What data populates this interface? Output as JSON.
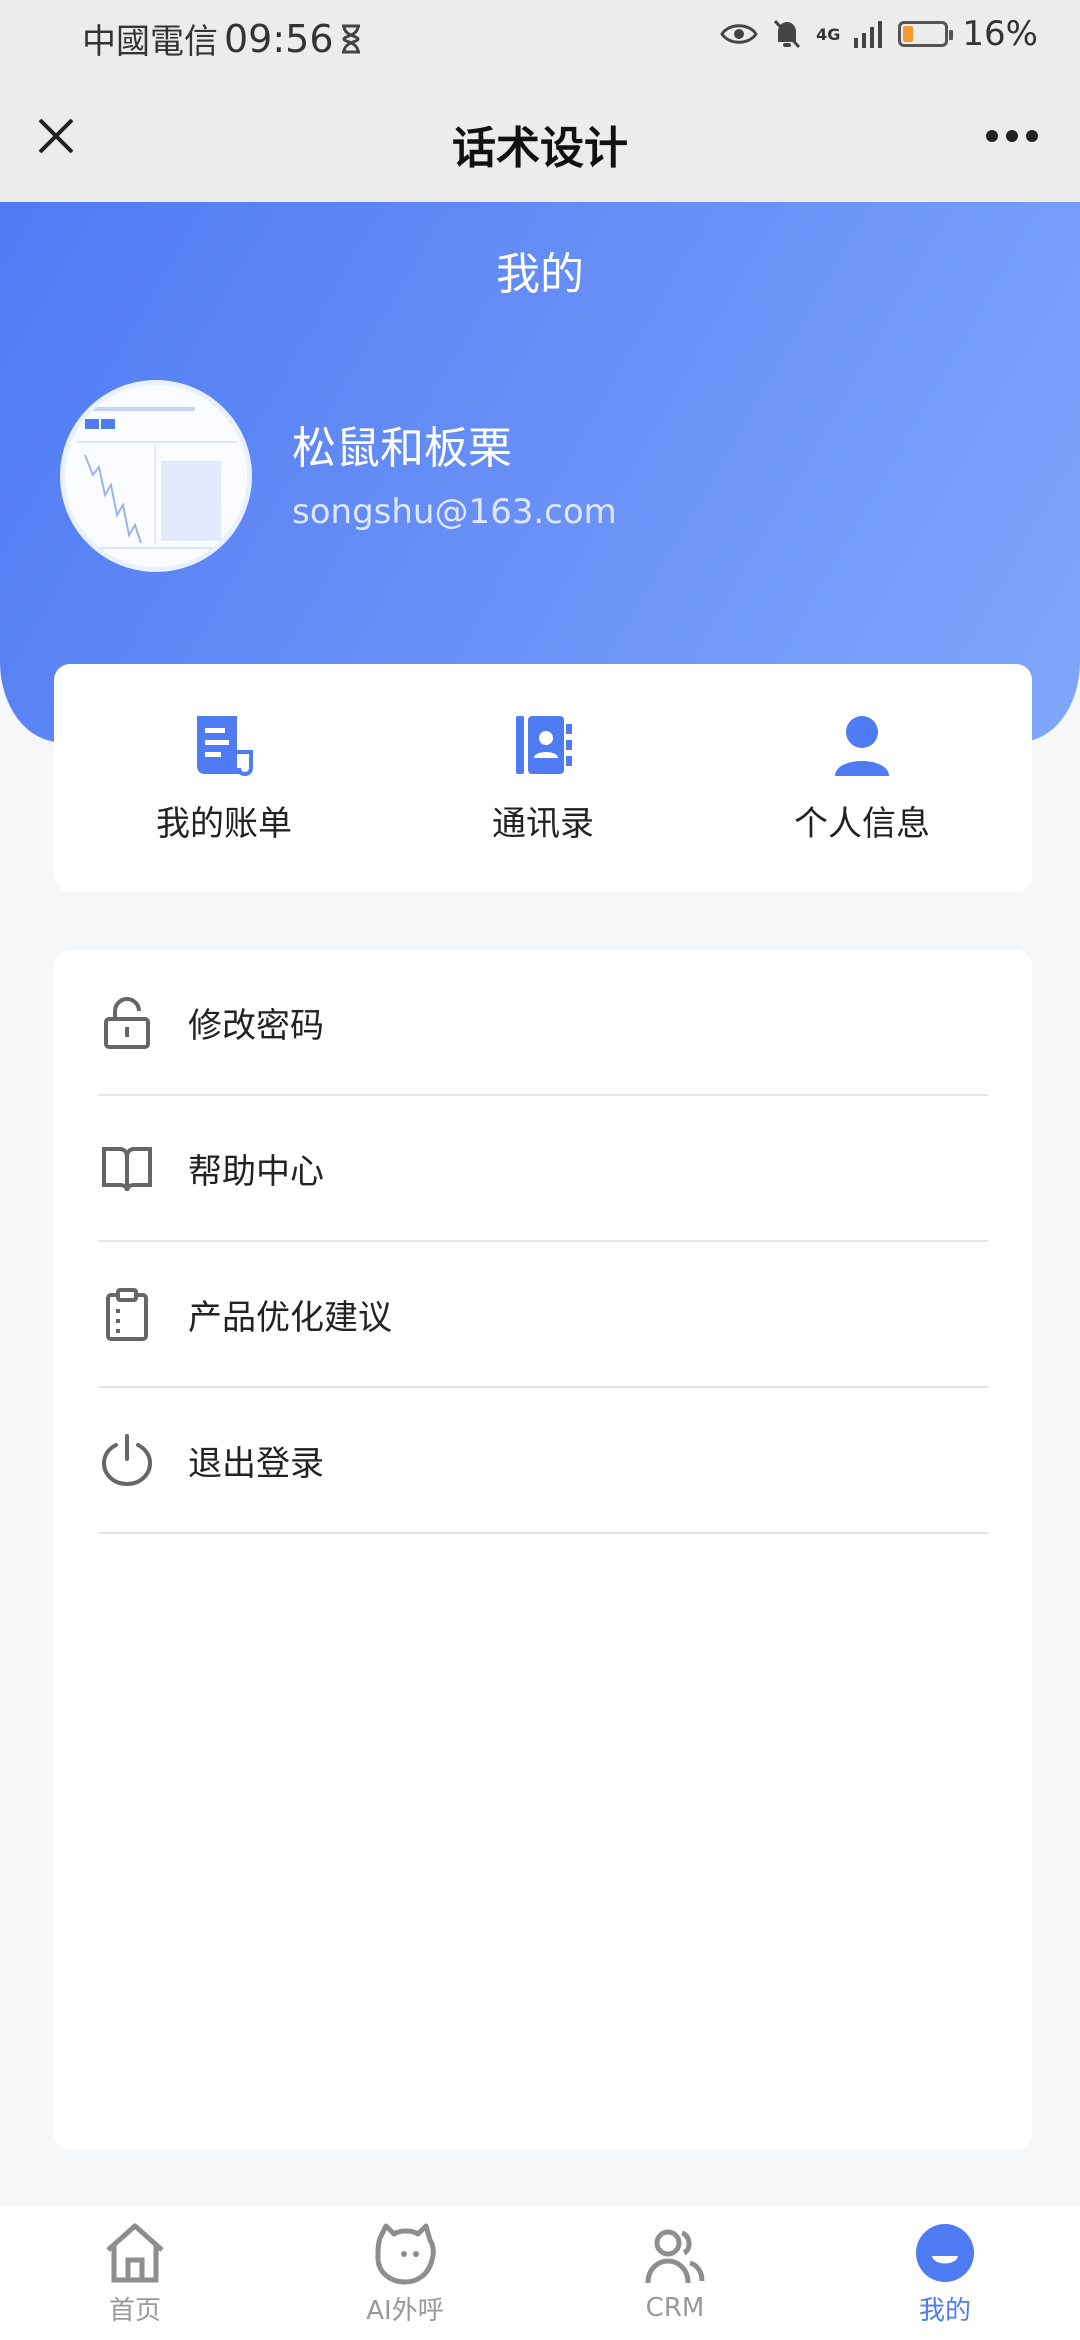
{
  "status_bar": {
    "carrier": "中國電信",
    "time": "09:56",
    "network": "4G",
    "battery": "16%"
  },
  "title_bar": {
    "title": "话术设计"
  },
  "header": {
    "title": "我的",
    "user_name": "松鼠和板栗",
    "user_email": "songshu@163.com"
  },
  "quick_actions": [
    {
      "label": "我的账单",
      "icon": "bill-icon"
    },
    {
      "label": "通讯录",
      "icon": "contacts-book-icon"
    },
    {
      "label": "个人信息",
      "icon": "person-icon"
    }
  ],
  "menu": [
    {
      "label": "修改密码",
      "icon": "unlock-icon"
    },
    {
      "label": "帮助中心",
      "icon": "book-icon"
    },
    {
      "label": "产品优化建议",
      "icon": "clipboard-icon"
    },
    {
      "label": "退出登录",
      "icon": "power-icon"
    }
  ],
  "bottom_nav": [
    {
      "label": "首页",
      "icon": "home-icon"
    },
    {
      "label": "AI外呼",
      "icon": "robot-icon"
    },
    {
      "label": "CRM",
      "icon": "users-icon"
    },
    {
      "label": "我的",
      "icon": "profile-icon",
      "active": true
    }
  ],
  "colors": {
    "accent": "#4f7bf3",
    "header_gradient_start": "#4f7bf3",
    "header_gradient_end": "#80a7fb",
    "battery_low": "#f29a2e"
  }
}
